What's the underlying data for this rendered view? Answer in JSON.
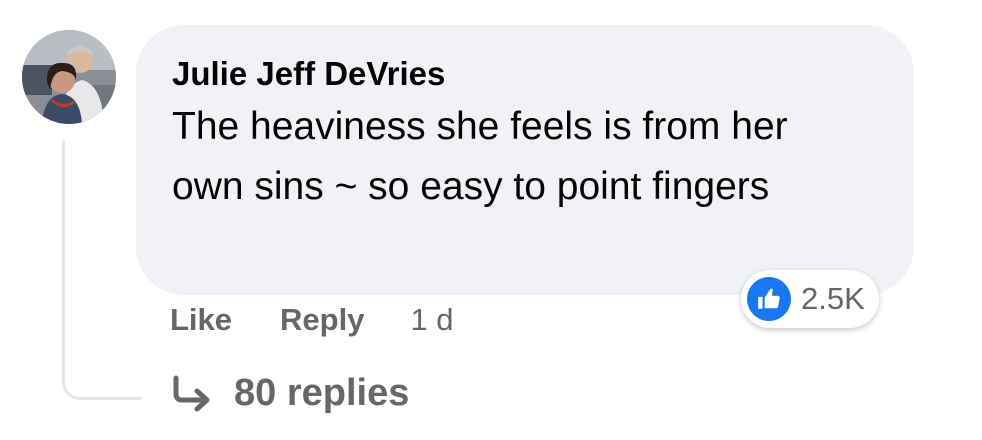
{
  "comment": {
    "author": "Julie Jeff DeVries",
    "text": "The heaviness she feels is from her own sins ~ so easy to point fingers",
    "avatar_icon": "user-avatar-photo",
    "reactions": {
      "icon": "thumbs-up-icon",
      "count": "2.5K",
      "badge_color": "#1877f2"
    },
    "actions": {
      "like_label": "Like",
      "reply_label": "Reply",
      "timestamp": "1 d"
    },
    "replies": {
      "icon": "reply-arrow-icon",
      "label": "80 replies"
    }
  },
  "colors": {
    "bubble_bg": "#f0f2f5",
    "text": "#050505",
    "secondary_text": "#65676b",
    "thread_line": "#e4e6eb"
  }
}
